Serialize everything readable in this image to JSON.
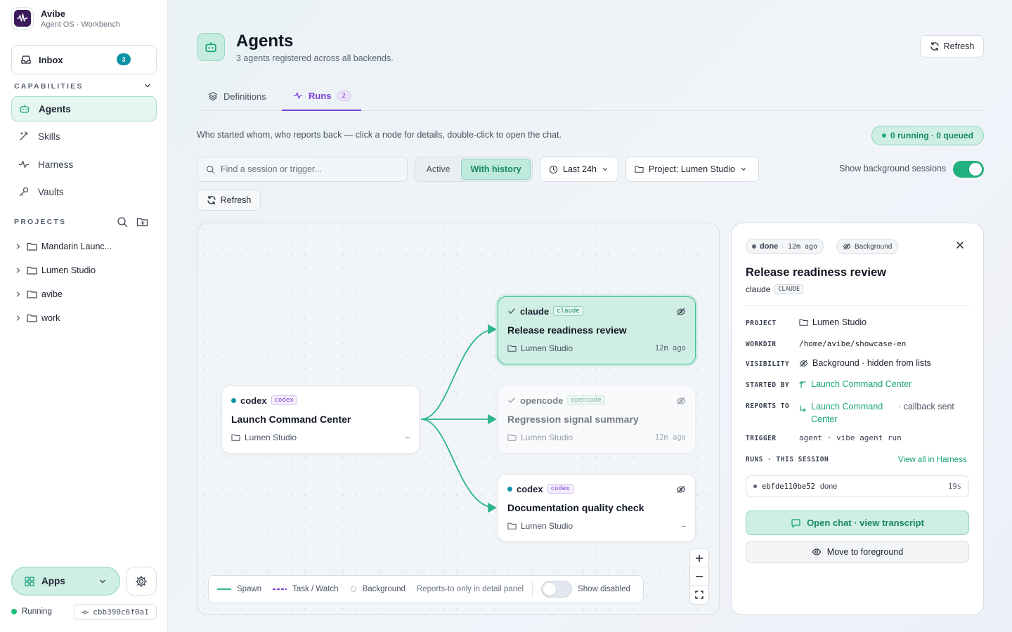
{
  "brand": {
    "name": "Avibe",
    "subtitle": "Agent OS · Workbench"
  },
  "inbox": {
    "label": "Inbox",
    "count": "3"
  },
  "capabilities": {
    "heading": "CAPABILITIES",
    "items": [
      {
        "label": "Agents",
        "icon": "robot-icon",
        "active": true
      },
      {
        "label": "Skills",
        "icon": "wand-icon"
      },
      {
        "label": "Harness",
        "icon": "activity-icon"
      },
      {
        "label": "Vaults",
        "icon": "key-icon"
      }
    ]
  },
  "projects": {
    "heading": "PROJECTS",
    "items": [
      {
        "label": "Mandarin Launc..."
      },
      {
        "label": "Lumen Studio"
      },
      {
        "label": "avibe"
      },
      {
        "label": "work"
      }
    ]
  },
  "footer": {
    "apps_label": "Apps",
    "status": "Running",
    "commit": "cbb390c6f0a1"
  },
  "page": {
    "title": "Agents",
    "subtitle": "3 agents registered across all backends.",
    "refresh_label": "Refresh",
    "tabs": [
      {
        "label": "Definitions"
      },
      {
        "label": "Runs",
        "count": "2",
        "active": true
      }
    ],
    "description": "Who started whom, who reports back — click a node for details, double-click to open the chat.",
    "running_pill": "0 running · 0 queued"
  },
  "filters": {
    "search_placeholder": "Find a session or trigger...",
    "segment": [
      "Active",
      "With history"
    ],
    "time_range": "Last 24h",
    "project": "Project: Lumen Studio",
    "background_label": "Show background sessions",
    "refresh_label": "Refresh"
  },
  "graph": {
    "nodes": [
      {
        "agent": "codex",
        "tag": "codex",
        "title": "Launch Command Center",
        "project": "Lumen Studio",
        "time": "–",
        "status": "dot"
      },
      {
        "agent": "claude",
        "tag": "claude",
        "title": "Release readiness review",
        "project": "Lumen Studio",
        "time": "12m ago",
        "status": "check"
      },
      {
        "agent": "opencode",
        "tag": "opencode",
        "title": "Regression signal summary",
        "project": "Lumen Studio",
        "time": "12m ago",
        "status": "check"
      },
      {
        "agent": "codex",
        "tag": "codex",
        "title": "Documentation quality check",
        "project": "Lumen Studio",
        "time": "–",
        "status": "dot"
      }
    ],
    "legend": {
      "spawn": "Spawn",
      "task": "Task / Watch",
      "background": "Background",
      "note": "Reports-to only in detail panel",
      "show_disabled": "Show disabled"
    },
    "colors": {
      "spawn": "#2bb58a",
      "task": "#7a3fd6",
      "codex_dot": "#0e93a6"
    }
  },
  "detail": {
    "status": "done",
    "age": "12m ago",
    "visibility_chip": "Background",
    "title": "Release readiness review",
    "agent": "claude",
    "agent_badge": "CLAUDE",
    "fields": {
      "project_label": "PROJECT",
      "project": "Lumen Studio",
      "workdir_label": "WORKDIR",
      "workdir": "/home/avibe/showcase-en",
      "visibility_label": "VISIBILITY",
      "visibility": "Background · hidden from lists",
      "started_label": "STARTED BY",
      "started": "Launch Command Center",
      "reports_label": "REPORTS TO",
      "reports": "Launch Command Center",
      "reports_note": "· callback sent",
      "trigger_label": "TRIGGER",
      "trigger": "agent · vibe agent run"
    },
    "runs_heading": "RUNS · THIS SESSION",
    "runs_link": "View all in Harness",
    "run": {
      "id": "ebfde110be52",
      "status": "done",
      "duration": "19s"
    },
    "open_chat": "Open chat · view transcript",
    "foreground": "Move to foreground"
  }
}
